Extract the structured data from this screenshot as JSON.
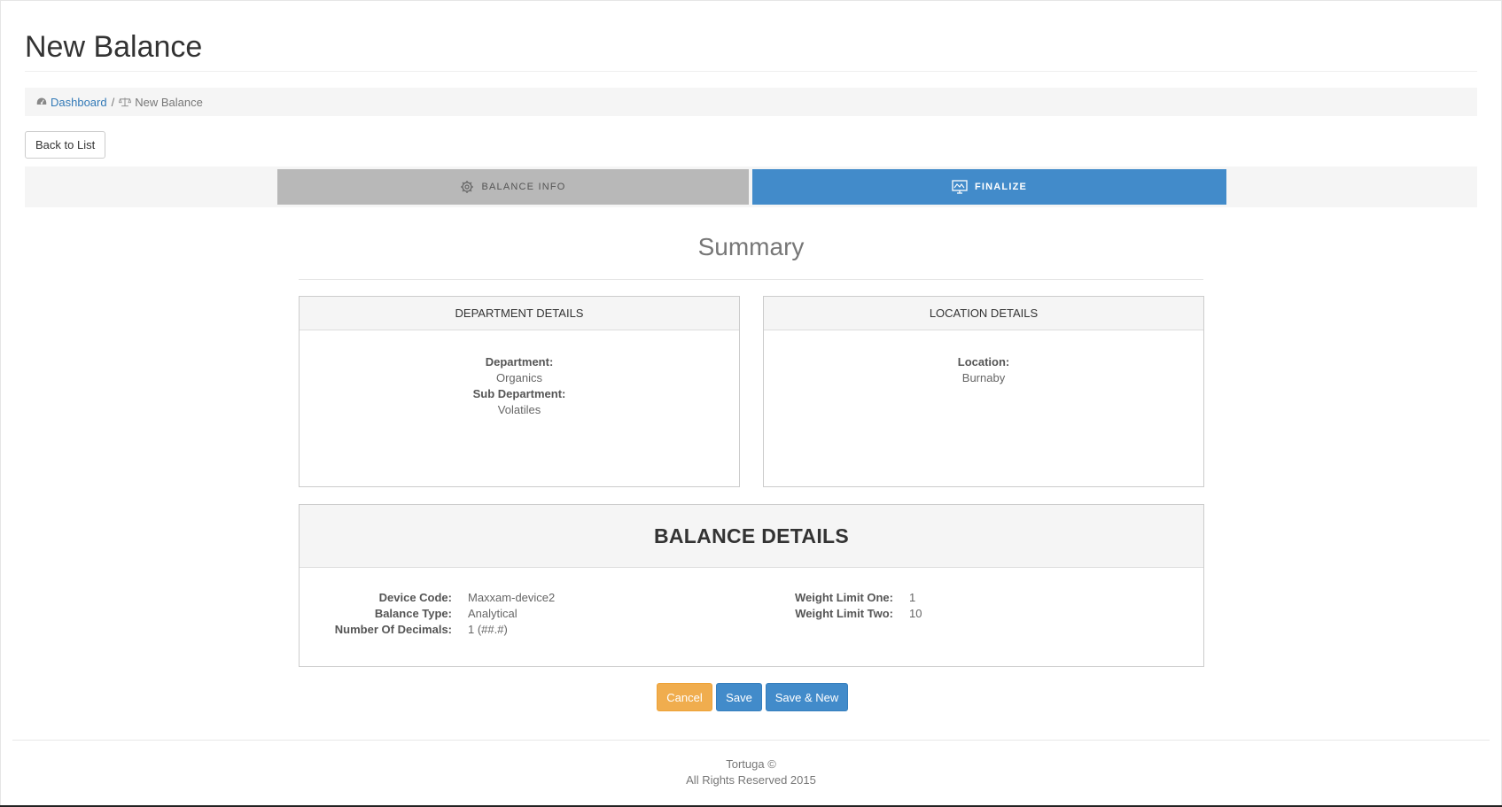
{
  "page": {
    "title": "New Balance"
  },
  "breadcrumb": {
    "home": "Dashboard",
    "separator": "/",
    "current": "New Balance"
  },
  "actions": {
    "back": "Back to List"
  },
  "wizard": {
    "steps": [
      {
        "label": "BALANCE INFO",
        "icon": "gear-icon",
        "active": false
      },
      {
        "label": "FINALIZE",
        "icon": "monitor-chart-icon",
        "active": true
      }
    ]
  },
  "summary": {
    "title": "Summary",
    "department": {
      "header": "DEPARTMENT DETAILS",
      "department_label": "Department:",
      "department_value": "Organics",
      "sub_department_label": "Sub Department:",
      "sub_department_value": "Volatiles"
    },
    "location": {
      "header": "LOCATION DETAILS",
      "location_label": "Location:",
      "location_value": "Burnaby"
    },
    "balance": {
      "header": "BALANCE DETAILS",
      "left": [
        {
          "label": "Device Code:",
          "value": "Maxxam-device2"
        },
        {
          "label": "Balance Type:",
          "value": "Analytical"
        },
        {
          "label": "Number Of Decimals:",
          "value": "1 (##.#)"
        }
      ],
      "right": [
        {
          "label": "Weight Limit One:",
          "value": "1"
        },
        {
          "label": "Weight Limit Two:",
          "value": "10"
        }
      ]
    }
  },
  "buttons": {
    "cancel": "Cancel",
    "save": "Save",
    "save_new": "Save & New"
  },
  "footer": {
    "line1": "Tortuga ©",
    "line2": "All Rights Reserved 2015"
  },
  "colors": {
    "primary": "#428bca",
    "warning": "#f0ad4e",
    "step_inactive": "#b8b8b8"
  }
}
